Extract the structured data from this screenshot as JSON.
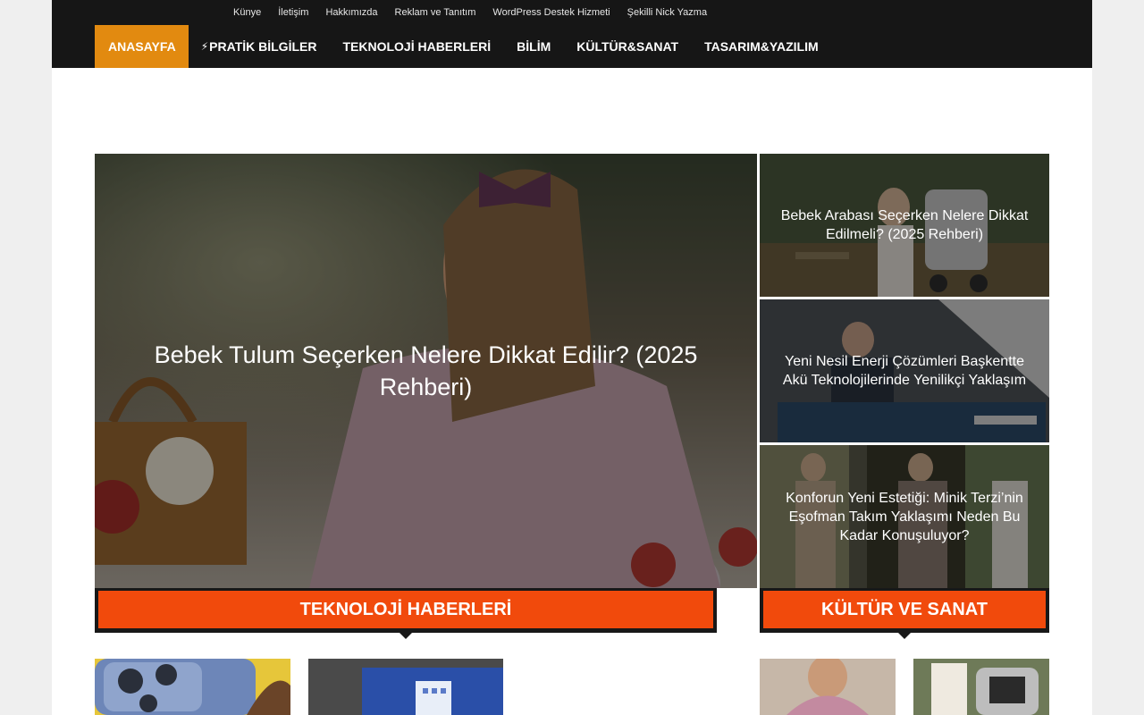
{
  "top_nav": [
    "Künye",
    "İletişim",
    "Hakkımızda",
    "Reklam ve Tanıtım",
    "WordPress Destek Hizmeti",
    "Şekilli Nick Yazma"
  ],
  "main_nav": [
    {
      "icon": "",
      "label": "ANASAYFA",
      "active": true
    },
    {
      "icon": "⚡",
      "label": "PRATİK BİLGİLER"
    },
    {
      "icon": "",
      "label": "TEKNOLOJİ HABERLERİ"
    },
    {
      "icon": "",
      "label": "BİLİM"
    },
    {
      "icon": "",
      "label": "KÜLTÜR&SANAT"
    },
    {
      "icon": "",
      "label": "TASARIM&YAZILIM"
    }
  ],
  "slider": {
    "main": {
      "title": "Bebek Tulum Seçerken Nelere Dikkat Edilir? (2025 Rehberi)"
    },
    "side": [
      {
        "title": "Bebek Arabası Seçerken Nelere Dikkat Edilmeli? (2025 Rehberi)"
      },
      {
        "title": "Yeni Nesil Enerji Çözümleri Başkentte Akü Teknolojilerinde Yenilikçi Yaklaşım"
      },
      {
        "title": "Konforun Yeni Estetiği: Minik Terzi’nin Eşofman Takım Yaklaşımı Neden Bu Kadar Konuşuluyor?"
      }
    ]
  },
  "sections": {
    "tech": {
      "title": "TEKNOLOJİ HABERLERİ"
    },
    "culture": {
      "title": "KÜLTÜR VE SANAT"
    }
  },
  "colors": {
    "header_bg": "#161616",
    "active_nav": "#e28a10",
    "section_accent": "#f14a0c"
  }
}
